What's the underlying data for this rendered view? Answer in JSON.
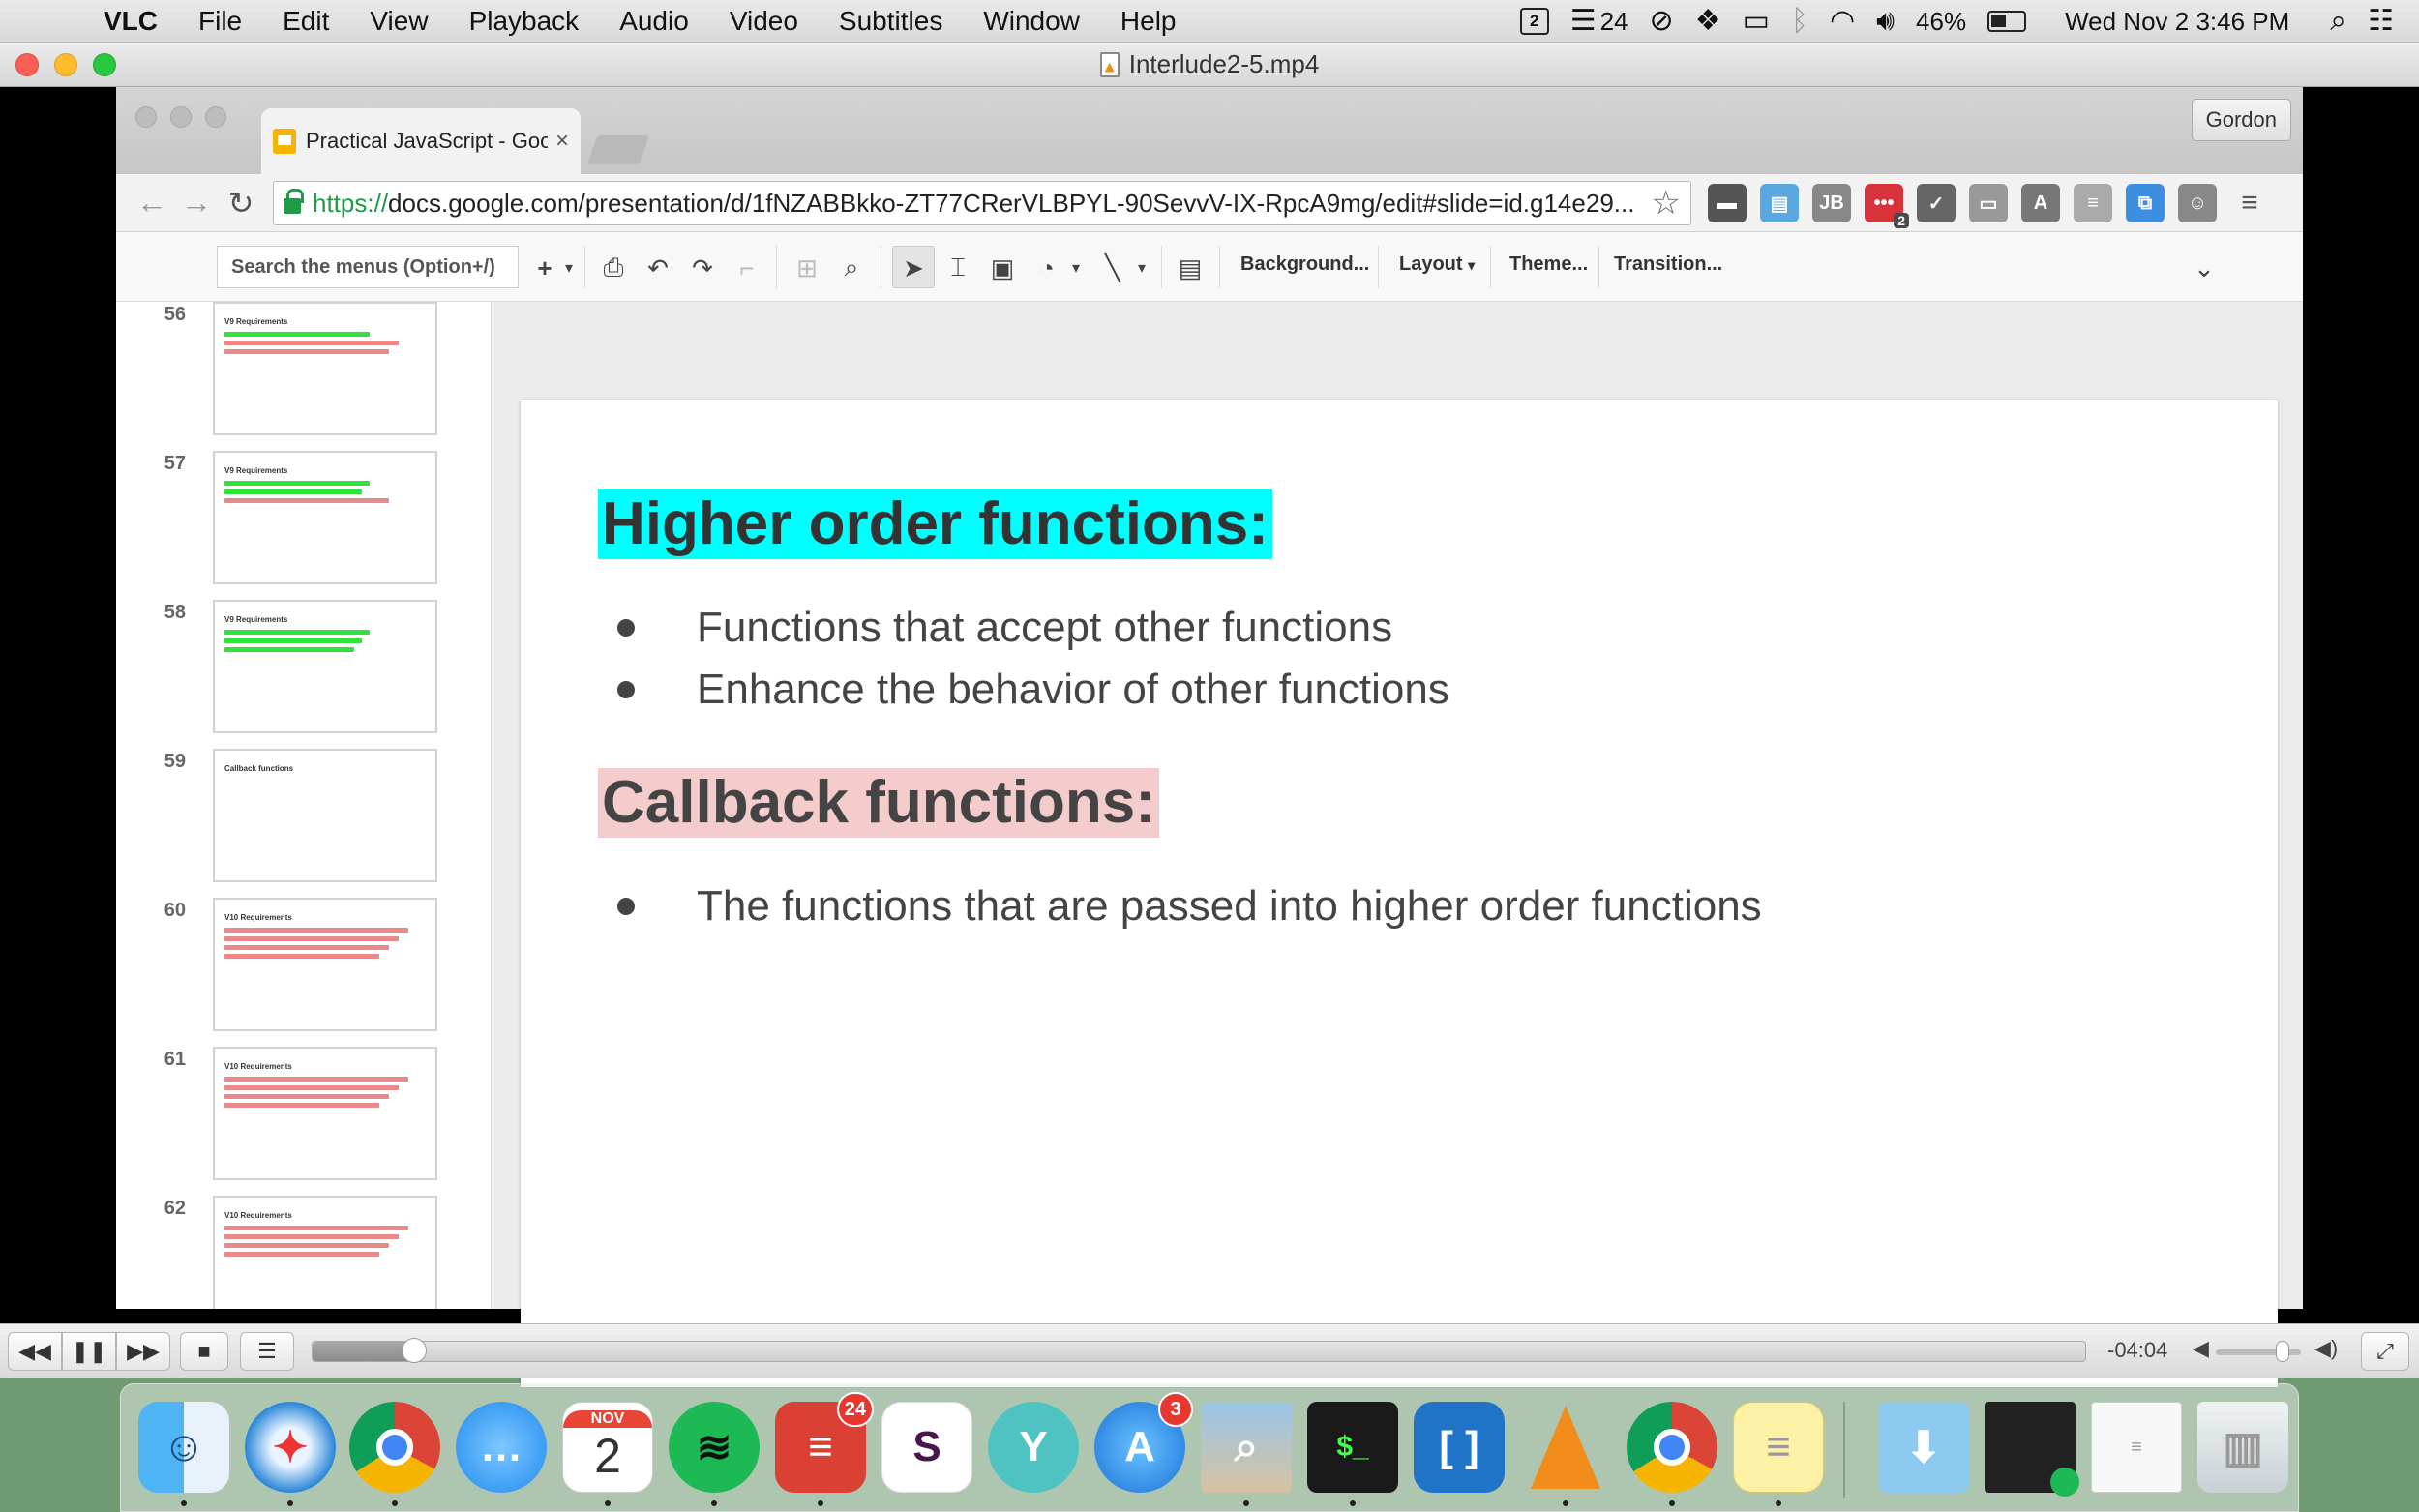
{
  "menubar": {
    "app_name": "VLC",
    "menus": [
      "File",
      "Edit",
      "View",
      "Playback",
      "Audio",
      "Video",
      "Subtitles",
      "Window",
      "Help"
    ],
    "status": {
      "calendar_day": "2",
      "todo_count": "24",
      "battery": "46%",
      "datetime": "Wed Nov 2  3:46 PM"
    }
  },
  "vlc": {
    "window_title": "Interlude2-5.mp4",
    "time_remaining": "-04:04",
    "progress_fraction": 0.057,
    "volume_fraction": 0.78
  },
  "chrome": {
    "tab_title": "Practical JavaScript - Goo",
    "profile": "Gordon",
    "url_scheme": "https://",
    "url_rest": "docs.google.com/presentation/d/1fNZABBkko-ZT77CRerVLBPYL-90SevvV-IX-RpcA9mg/edit#slide=id.g14e29...",
    "ext_badge": "2"
  },
  "slides_toolbar": {
    "menu_search": "Search the menus (Option+/)",
    "background": "Background...",
    "layout": "Layout",
    "theme": "Theme...",
    "transition": "Transition..."
  },
  "filmstrip": [
    {
      "num": "56",
      "title": "V9 Requirements",
      "lines": [
        "green",
        "red",
        "red"
      ]
    },
    {
      "num": "57",
      "title": "V9 Requirements",
      "lines": [
        "green",
        "green",
        "red"
      ]
    },
    {
      "num": "58",
      "title": "V9 Requirements",
      "lines": [
        "green",
        "green",
        "green"
      ]
    },
    {
      "num": "59",
      "title": "Callback functions",
      "lines": []
    },
    {
      "num": "60",
      "title": "V10 Requirements",
      "lines": [
        "red",
        "red",
        "red",
        "red"
      ]
    },
    {
      "num": "61",
      "title": "V10 Requirements",
      "lines": [
        "red",
        "red",
        "red",
        "red"
      ]
    },
    {
      "num": "62",
      "title": "V10 Requirements",
      "lines": [
        "red",
        "red",
        "red",
        "red"
      ]
    }
  ],
  "slide": {
    "heading_1": "Higher order functions:",
    "bullets_1": [
      "Functions that accept other functions",
      "Enhance the behavior of other functions"
    ],
    "heading_2": "Callback functions:",
    "bullets_2": [
      "The functions that are passed into higher order functions"
    ],
    "colors": {
      "heading_1_highlight": "#00ffff",
      "heading_2_highlight": "#f4cccc"
    }
  },
  "dock": {
    "calendar_month": "NOV",
    "calendar_day": "2",
    "todoist_badge": "24",
    "appstore_badge": "3"
  }
}
